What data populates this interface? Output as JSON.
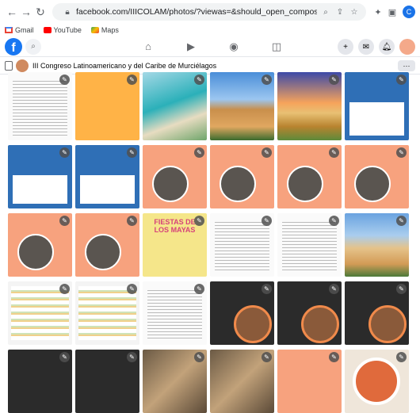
{
  "browser": {
    "url": "facebook.com/IIICOLAM/photos/?viewas=&should_open_composer=false&bypass_exit_w...",
    "profile_initial": "C",
    "bookmarks": [
      {
        "label": "Gmail",
        "color": "#ea4335"
      },
      {
        "label": "YouTube",
        "color": "#ff0000"
      },
      {
        "label": "Maps",
        "color": "#34a853"
      }
    ]
  },
  "facebook": {
    "logo": "f"
  },
  "page": {
    "title": "III Congreso Latinoamericano y del Caribe de Murciélagos",
    "more": "···"
  },
  "photos": {
    "edit_icon": "✎",
    "fiesta_text": "FIESTAS DE LOS MAYAS"
  },
  "colors": {
    "accent": "#1877f2",
    "peach": "#f7a27e",
    "congress_blue": "#2f6fb6"
  }
}
